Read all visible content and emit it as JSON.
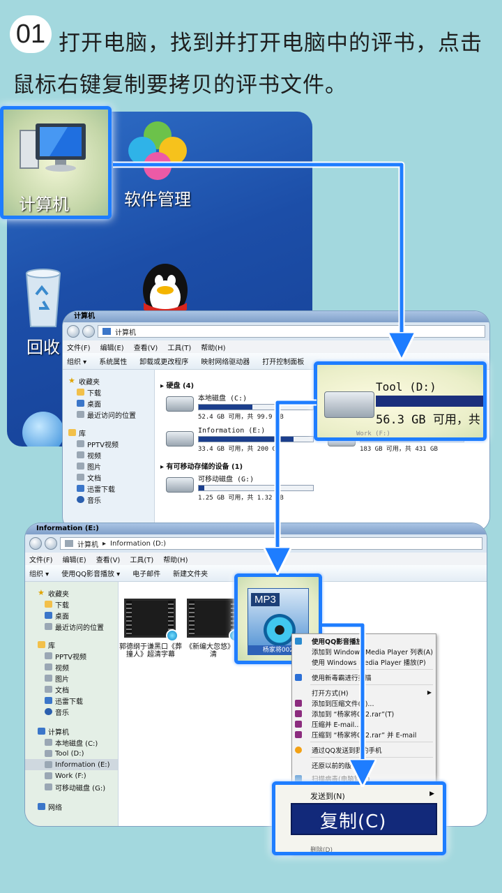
{
  "header": {
    "step": "01",
    "line1": "打开电脑，找到并打开电脑中的评书，点击",
    "line2": "鼠标右键复制要拷贝的评书文件。"
  },
  "desktop": {
    "computer": "计算机",
    "software": "软件管理",
    "recycle": "回收"
  },
  "win1": {
    "title": "计算机",
    "address": "计算机",
    "menu": [
      "文件(F)",
      "编辑(E)",
      "查看(V)",
      "工具(T)",
      "帮助(H)"
    ],
    "toolbar": [
      "组织 ▾",
      "系统属性",
      "卸载或更改程序",
      "映射网络驱动器",
      "打开控制面板"
    ],
    "nav": {
      "favorites": "收藏夹",
      "downloads": "下载",
      "desktop": "桌面",
      "recent": "最近访问的位置",
      "libraries": "库",
      "pptv": "PPTV视频",
      "videos": "视频",
      "pictures": "图片",
      "docs": "文档",
      "thunder": "迅雷下载",
      "music": "音乐"
    },
    "hard_disks": "硬盘 (4)",
    "removable": "有可移动存储的设备 (1)",
    "c_name": "本地磁盘 (C:)",
    "c_text": "52.4 GB 可用，共 99.9 GB",
    "c_used": 0.47,
    "e_name": "Information (E:)",
    "e_text": "33.4 GB 可用，共 200 GB",
    "e_used": 0.83,
    "f_text": "183 GB 可用，共 431 GB",
    "f_used": 0.58,
    "g_name": "可移动磁盘 (G:)",
    "g_text": "1.25 GB 可用，共 1.32 GB",
    "g_used": 0.05
  },
  "tool_callout": {
    "name": "Tool (D:)",
    "free": "56.3 GB 可用，共",
    "work": "Work (F:)"
  },
  "win2": {
    "title": "Information (E:)",
    "address": [
      "计算机",
      "Information (D:)"
    ],
    "menu": [
      "文件(F)",
      "编辑(E)",
      "查看(V)",
      "工具(T)",
      "帮助(H)"
    ],
    "toolbar": [
      "组织 ▾",
      "使用QQ影音播放 ▾",
      "电子邮件",
      "新建文件夹"
    ],
    "nav": {
      "favorites": "收藏夹",
      "downloads": "下载",
      "desktop": "桌面",
      "recent": "最近访问的位置",
      "libraries": "库",
      "pptv": "PPTV视频",
      "videos": "视频",
      "pictures": "图片",
      "docs": "文档",
      "thunder": "迅雷下载",
      "music": "音乐",
      "computer": "计算机",
      "c": "本地磁盘 (C:)",
      "d": "Tool (D:)",
      "e": "Information (E:)",
      "f": "Work (F:)",
      "g": "可移动磁盘 (G:)",
      "network": "网络"
    },
    "file1_caption": "郭德纲于谦黑口《葬撞人》超清字幕",
    "file2_caption": "《新编大忽悠》标清",
    "mp3_tag": "MP3",
    "mp3_name": "杨家将002"
  },
  "context_menu": {
    "items": [
      "使用QQ影音播放",
      "添加到 Windows Media Player 列表(A)",
      "使用 Windows Media Player 播放(P)",
      "使用新毒霸进行扫描",
      "打开方式(H)",
      "添加到压缩文件(A)...",
      "添加到 “杨家将002.rar”(T)",
      "压缩并 E-mail...",
      "压缩到 “杨家将002.rar” 并 E-mail",
      "通过QQ发送到我的手机",
      "还原以前的版本(V)",
      "扫描病毒(电脑管家)"
    ],
    "send_to": "发送到(N)",
    "copy": "复制(C)",
    "delete": "删除(D)"
  }
}
